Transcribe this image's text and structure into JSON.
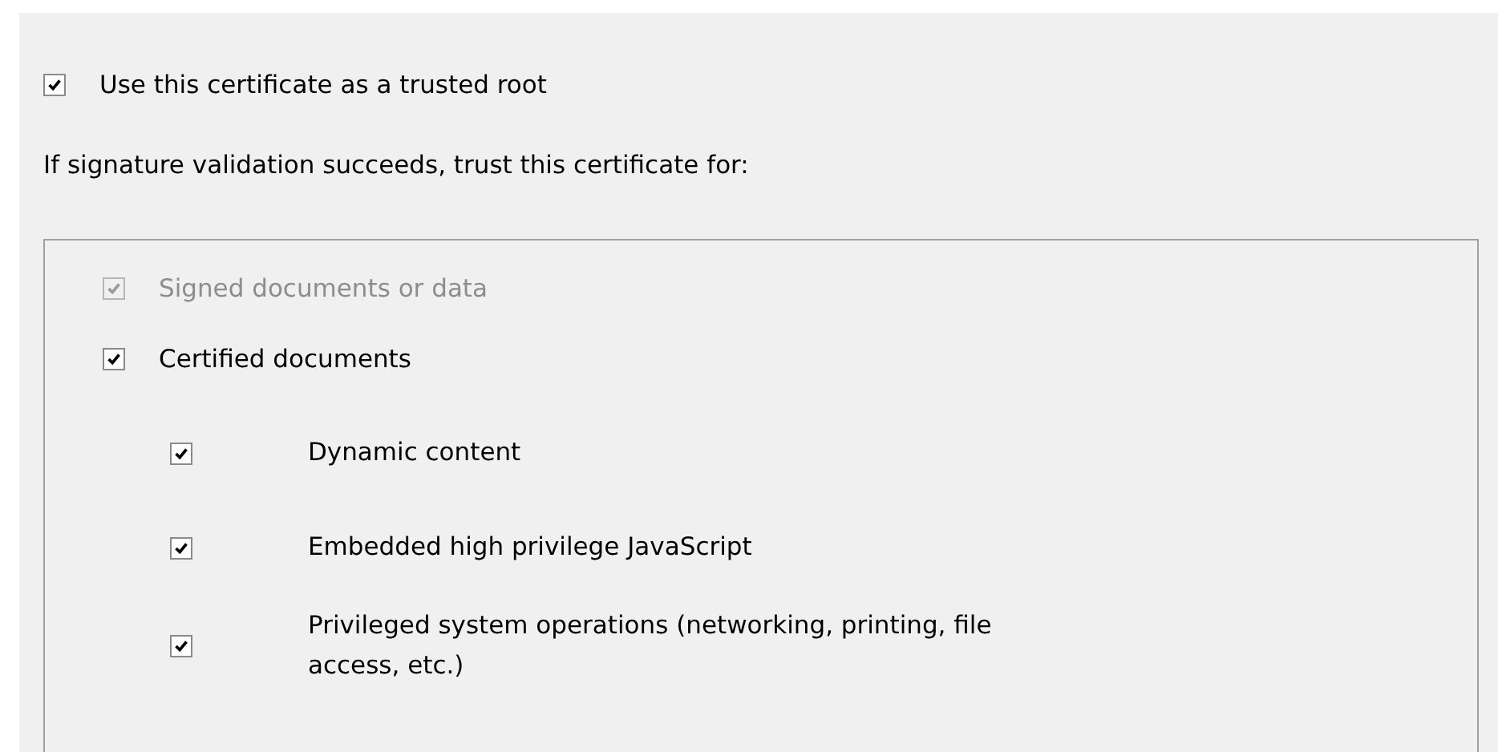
{
  "trusted_root": {
    "label": "Use this certificate as a trusted root",
    "checked": true
  },
  "trust_prompt": "If signature validation succeeds, trust this certificate for:",
  "trust_options": [
    {
      "label": "Signed documents or data",
      "checked": true,
      "disabled": true
    },
    {
      "label": "Certified documents",
      "checked": true,
      "disabled": false,
      "children": [
        {
          "label": "Dynamic content",
          "checked": true,
          "disabled": false
        },
        {
          "label": "Embedded high privilege JavaScript",
          "checked": true,
          "disabled": false
        },
        {
          "label": "Privileged system operations (networking, printing, file access, etc.)",
          "checked": true,
          "disabled": false
        }
      ]
    }
  ]
}
